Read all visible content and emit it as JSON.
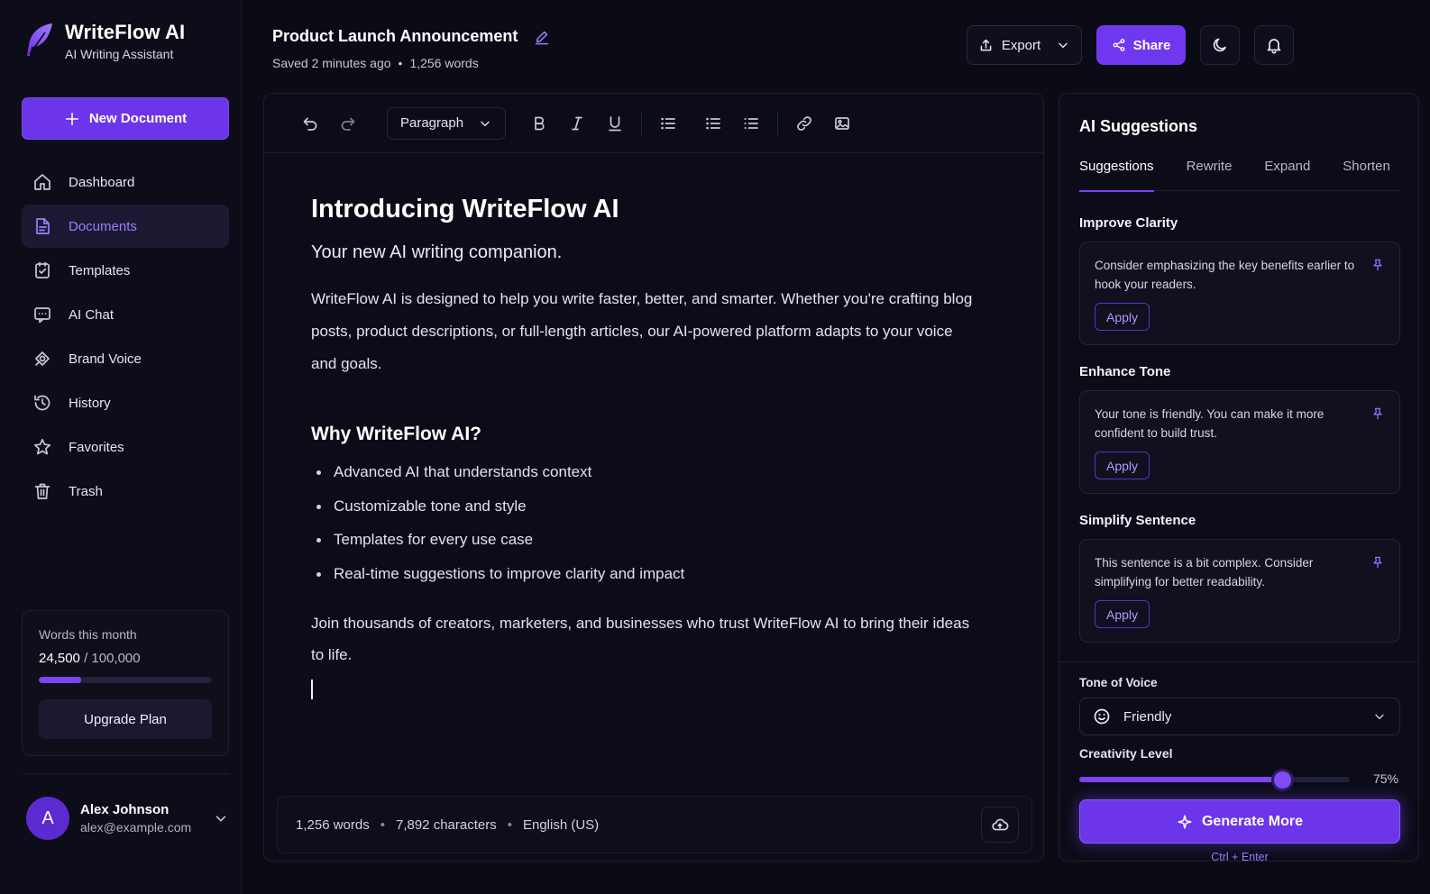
{
  "brand": {
    "name": "WriteFlow AI",
    "subtitle": "AI Writing Assistant"
  },
  "sidebar": {
    "new_document_label": "New Document",
    "items": [
      {
        "label": "Dashboard",
        "icon": "home-icon"
      },
      {
        "label": "Documents",
        "icon": "document-icon",
        "active": true
      },
      {
        "label": "Templates",
        "icon": "template-icon"
      },
      {
        "label": "AI Chat",
        "icon": "chat-icon"
      },
      {
        "label": "Brand Voice",
        "icon": "brand-voice-icon"
      },
      {
        "label": "History",
        "icon": "history-icon"
      },
      {
        "label": "Favorites",
        "icon": "star-icon"
      },
      {
        "label": "Trash",
        "icon": "trash-icon"
      }
    ],
    "usage": {
      "label": "Words this month",
      "used": "24,500",
      "limit": "/ 100,000",
      "fraction": 0.245,
      "upgrade_label": "Upgrade Plan"
    },
    "user": {
      "initial": "A",
      "name": "Alex Johnson",
      "email": "alex@example.com"
    }
  },
  "header": {
    "title": "Product Launch Announcement",
    "saved": "Saved 2 minutes ago",
    "separator": "•",
    "words": "1,256 words",
    "export_label": "Export",
    "share_label": "Share"
  },
  "toolbar": {
    "block_style": "Paragraph"
  },
  "document": {
    "h1": "Introducing WriteFlow AI",
    "subtitle": "Your new AI writing companion.",
    "intro": "WriteFlow AI is designed to help you write faster, better, and smarter. Whether you're crafting blog posts, product descriptions, or full-length articles, our AI-powered platform adapts to your voice and goals.",
    "h2": "Why WriteFlow AI?",
    "bullets": [
      "Advanced AI that understands context",
      "Customizable tone and style",
      "Templates for every use case",
      "Real-time suggestions to improve clarity and impact"
    ],
    "closing": "Join thousands of creators, marketers, and businesses who trust WriteFlow AI to bring their ideas to life."
  },
  "statusbar": {
    "words": "1,256 words",
    "characters": "7,892 characters",
    "language": "English (US)",
    "separator": "•"
  },
  "panel": {
    "title": "AI Suggestions",
    "tabs": [
      "Suggestions",
      "Rewrite",
      "Expand",
      "Shorten"
    ],
    "suggestions": [
      {
        "heading": "Improve Clarity",
        "text": "Consider emphasizing the key benefits earlier to hook your readers.",
        "apply_label": "Apply"
      },
      {
        "heading": "Enhance Tone",
        "text": "Your tone is friendly. You can make it more confident to build trust.",
        "apply_label": "Apply"
      },
      {
        "heading": "Simplify Sentence",
        "text": "This sentence is a bit complex. Consider simplifying for better readability.",
        "apply_label": "Apply"
      }
    ],
    "tone_label": "Tone of Voice",
    "tone_value": "Friendly",
    "creativity_label": "Creativity Level",
    "creativity_value": "75%",
    "creativity_fraction": 0.75,
    "generate_label": "Generate More",
    "generate_hint": "Ctrl + Enter"
  },
  "colors": {
    "accent": "#6d35ea",
    "accent_text": "#9d7bff",
    "background": "#0b0b16"
  }
}
